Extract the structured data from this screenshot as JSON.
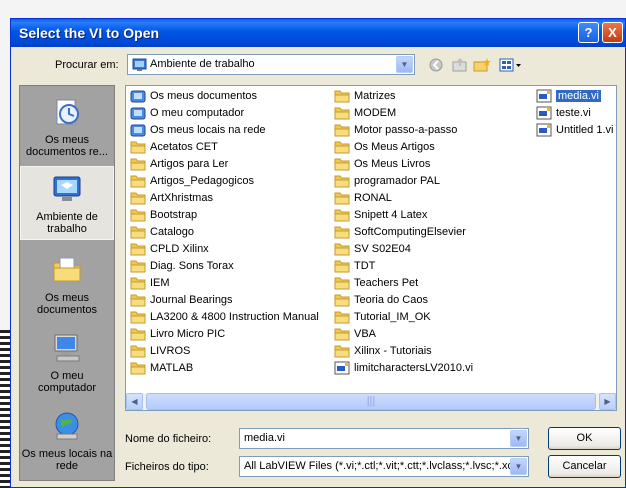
{
  "window": {
    "title": "Select the VI to Open",
    "help_glyph": "?",
    "close_glyph": "X"
  },
  "lookin": {
    "label": "Procurar em:",
    "value": "Ambiente de trabalho"
  },
  "places": [
    {
      "label": "Os meus documentos re...",
      "icon": "recent-documents-icon"
    },
    {
      "label": "Ambiente de trabalho",
      "icon": "desktop-icon"
    },
    {
      "label": "Os meus documentos",
      "icon": "my-documents-icon"
    },
    {
      "label": "O meu computador",
      "icon": "my-computer-icon"
    },
    {
      "label": "Os meus locais na rede",
      "icon": "network-places-icon"
    }
  ],
  "files": {
    "col1": [
      {
        "name": "Os meus documentos",
        "type": "sys"
      },
      {
        "name": "O meu computador",
        "type": "sys"
      },
      {
        "name": "Os meus locais na rede",
        "type": "sys"
      },
      {
        "name": "Acetatos CET",
        "type": "folder"
      },
      {
        "name": "Artigos para Ler",
        "type": "folder"
      },
      {
        "name": "Artigos_Pedagogicos",
        "type": "folder"
      },
      {
        "name": "ArtXhristmas",
        "type": "folder"
      },
      {
        "name": "Bootstrap",
        "type": "folder"
      },
      {
        "name": "Catalogo",
        "type": "folder"
      },
      {
        "name": "CPLD Xilinx",
        "type": "folder"
      },
      {
        "name": "Diag. Sons Torax",
        "type": "folder"
      },
      {
        "name": "IEM",
        "type": "folder"
      },
      {
        "name": "Journal Bearings",
        "type": "folder"
      },
      {
        "name": "LA3200 & 4800 Instruction Manual",
        "type": "folder"
      },
      {
        "name": "Livro Micro PIC",
        "type": "folder"
      },
      {
        "name": "LIVROS",
        "type": "folder"
      },
      {
        "name": "MATLAB",
        "type": "folder"
      }
    ],
    "col2": [
      {
        "name": "Matrizes",
        "type": "folder"
      },
      {
        "name": "MODEM",
        "type": "folder"
      },
      {
        "name": "Motor passo-a-passo",
        "type": "folder"
      },
      {
        "name": "Os Meus Artigos",
        "type": "folder"
      },
      {
        "name": "Os Meus Livros",
        "type": "folder"
      },
      {
        "name": "programador PAL",
        "type": "folder"
      },
      {
        "name": "RONAL",
        "type": "folder"
      },
      {
        "name": "Snipett 4 Latex",
        "type": "folder"
      },
      {
        "name": "SoftComputingElsevier",
        "type": "folder"
      },
      {
        "name": "SV S02E04",
        "type": "folder"
      },
      {
        "name": "TDT",
        "type": "folder"
      },
      {
        "name": "Teachers Pet",
        "type": "folder"
      },
      {
        "name": "Teoria do Caos",
        "type": "folder"
      },
      {
        "name": "Tutorial_IM_OK",
        "type": "folder"
      },
      {
        "name": "VBA",
        "type": "folder"
      },
      {
        "name": "Xilinx - Tutoriais",
        "type": "folder"
      },
      {
        "name": "limitcharactersLV2010.vi",
        "type": "vi"
      }
    ],
    "col3": [
      {
        "name": "media.vi",
        "type": "vi",
        "selected": true
      },
      {
        "name": "teste.vi",
        "type": "vi"
      },
      {
        "name": "Untitled 1.vi",
        "type": "vi"
      }
    ]
  },
  "filename": {
    "label": "Nome do ficheiro:",
    "value": "media.vi"
  },
  "filetype": {
    "label": "Ficheiros do tipo:",
    "value": "All LabVIEW Files (*.vi;*.ctl;*.vit;*.ctt;*.lvclass;*.lvsc;*.xctl..."
  },
  "buttons": {
    "ok": "OK",
    "cancel": "Cancelar"
  },
  "colors": {
    "titlebar": "#0055e5",
    "selection": "#316ac5",
    "dialog_bg": "#ece9d8"
  }
}
